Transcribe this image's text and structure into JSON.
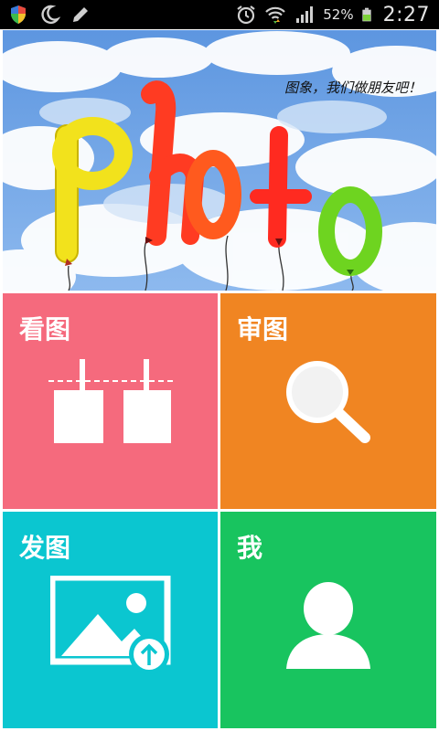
{
  "status_bar": {
    "battery_percent": "52%",
    "time": "2:27",
    "icons": [
      "shield-icon",
      "moon-icon",
      "pencil-icon",
      "alarm-icon",
      "wifi-icon",
      "signal-icon",
      "battery-icon"
    ]
  },
  "banner": {
    "word": "photo",
    "caption": "图象，我们做朋友吧！",
    "colors": {
      "p": "#f2e21c",
      "h": "#ff3b22",
      "o1": "#ff5a1e",
      "t": "#ff2a20",
      "o2": "#6ed420",
      "sky": "#6fa8e8"
    }
  },
  "tiles": [
    {
      "label": "看图",
      "color": "#f56a7d",
      "icon": "hanging-photos-icon"
    },
    {
      "label": "审图",
      "color": "#f08522",
      "icon": "magnifier-icon"
    },
    {
      "label": "发图",
      "color": "#0bc6d0",
      "icon": "upload-picture-icon"
    },
    {
      "label": "我",
      "color": "#18c45f",
      "icon": "user-icon"
    }
  ]
}
